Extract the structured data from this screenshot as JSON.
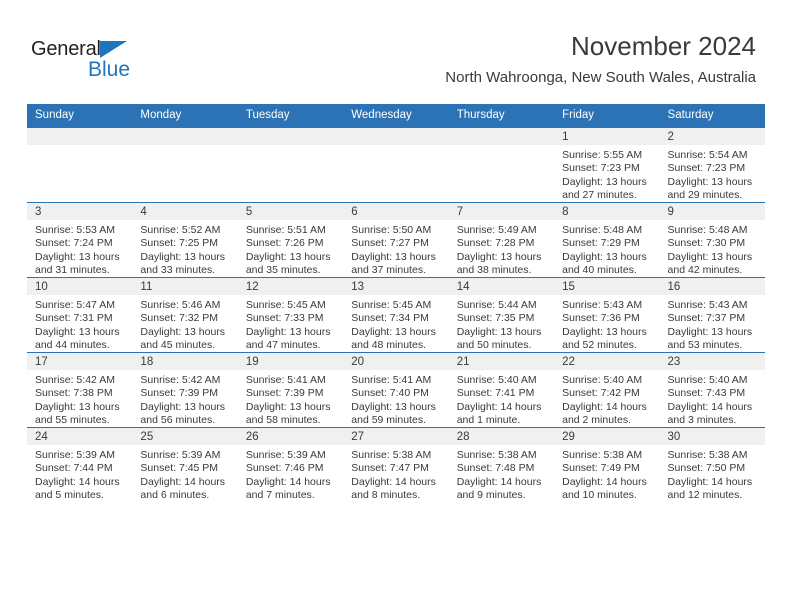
{
  "brand": {
    "name_top": "General",
    "name_bottom": "Blue",
    "color_dark": "#231f20",
    "color_blue": "#1f76bc"
  },
  "header": {
    "title": "November 2024",
    "subtitle": "North Wahroonga, New South Wales, Australia"
  },
  "theme": {
    "header_bg": "#2c73b5",
    "daynum_bg": "#f0f0f0",
    "text": "#3a3a3a"
  },
  "calendar": {
    "weekday_headers": [
      "Sunday",
      "Monday",
      "Tuesday",
      "Wednesday",
      "Thursday",
      "Friday",
      "Saturday"
    ],
    "labels": {
      "sunrise": "Sunrise:",
      "sunset": "Sunset:",
      "daylight": "Daylight:"
    },
    "weeks": [
      [
        {
          "day": "",
          "sunrise": "",
          "sunset": "",
          "daylight": ""
        },
        {
          "day": "",
          "sunrise": "",
          "sunset": "",
          "daylight": ""
        },
        {
          "day": "",
          "sunrise": "",
          "sunset": "",
          "daylight": ""
        },
        {
          "day": "",
          "sunrise": "",
          "sunset": "",
          "daylight": ""
        },
        {
          "day": "",
          "sunrise": "",
          "sunset": "",
          "daylight": ""
        },
        {
          "day": "1",
          "sunrise": "Sunrise: 5:55 AM",
          "sunset": "Sunset: 7:23 PM",
          "daylight": "Daylight: 13 hours and 27 minutes."
        },
        {
          "day": "2",
          "sunrise": "Sunrise: 5:54 AM",
          "sunset": "Sunset: 7:23 PM",
          "daylight": "Daylight: 13 hours and 29 minutes."
        }
      ],
      [
        {
          "day": "3",
          "sunrise": "Sunrise: 5:53 AM",
          "sunset": "Sunset: 7:24 PM",
          "daylight": "Daylight: 13 hours and 31 minutes."
        },
        {
          "day": "4",
          "sunrise": "Sunrise: 5:52 AM",
          "sunset": "Sunset: 7:25 PM",
          "daylight": "Daylight: 13 hours and 33 minutes."
        },
        {
          "day": "5",
          "sunrise": "Sunrise: 5:51 AM",
          "sunset": "Sunset: 7:26 PM",
          "daylight": "Daylight: 13 hours and 35 minutes."
        },
        {
          "day": "6",
          "sunrise": "Sunrise: 5:50 AM",
          "sunset": "Sunset: 7:27 PM",
          "daylight": "Daylight: 13 hours and 37 minutes."
        },
        {
          "day": "7",
          "sunrise": "Sunrise: 5:49 AM",
          "sunset": "Sunset: 7:28 PM",
          "daylight": "Daylight: 13 hours and 38 minutes."
        },
        {
          "day": "8",
          "sunrise": "Sunrise: 5:48 AM",
          "sunset": "Sunset: 7:29 PM",
          "daylight": "Daylight: 13 hours and 40 minutes."
        },
        {
          "day": "9",
          "sunrise": "Sunrise: 5:48 AM",
          "sunset": "Sunset: 7:30 PM",
          "daylight": "Daylight: 13 hours and 42 minutes."
        }
      ],
      [
        {
          "day": "10",
          "sunrise": "Sunrise: 5:47 AM",
          "sunset": "Sunset: 7:31 PM",
          "daylight": "Daylight: 13 hours and 44 minutes."
        },
        {
          "day": "11",
          "sunrise": "Sunrise: 5:46 AM",
          "sunset": "Sunset: 7:32 PM",
          "daylight": "Daylight: 13 hours and 45 minutes."
        },
        {
          "day": "12",
          "sunrise": "Sunrise: 5:45 AM",
          "sunset": "Sunset: 7:33 PM",
          "daylight": "Daylight: 13 hours and 47 minutes."
        },
        {
          "day": "13",
          "sunrise": "Sunrise: 5:45 AM",
          "sunset": "Sunset: 7:34 PM",
          "daylight": "Daylight: 13 hours and 48 minutes."
        },
        {
          "day": "14",
          "sunrise": "Sunrise: 5:44 AM",
          "sunset": "Sunset: 7:35 PM",
          "daylight": "Daylight: 13 hours and 50 minutes."
        },
        {
          "day": "15",
          "sunrise": "Sunrise: 5:43 AM",
          "sunset": "Sunset: 7:36 PM",
          "daylight": "Daylight: 13 hours and 52 minutes."
        },
        {
          "day": "16",
          "sunrise": "Sunrise: 5:43 AM",
          "sunset": "Sunset: 7:37 PM",
          "daylight": "Daylight: 13 hours and 53 minutes."
        }
      ],
      [
        {
          "day": "17",
          "sunrise": "Sunrise: 5:42 AM",
          "sunset": "Sunset: 7:38 PM",
          "daylight": "Daylight: 13 hours and 55 minutes."
        },
        {
          "day": "18",
          "sunrise": "Sunrise: 5:42 AM",
          "sunset": "Sunset: 7:39 PM",
          "daylight": "Daylight: 13 hours and 56 minutes."
        },
        {
          "day": "19",
          "sunrise": "Sunrise: 5:41 AM",
          "sunset": "Sunset: 7:39 PM",
          "daylight": "Daylight: 13 hours and 58 minutes."
        },
        {
          "day": "20",
          "sunrise": "Sunrise: 5:41 AM",
          "sunset": "Sunset: 7:40 PM",
          "daylight": "Daylight: 13 hours and 59 minutes."
        },
        {
          "day": "21",
          "sunrise": "Sunrise: 5:40 AM",
          "sunset": "Sunset: 7:41 PM",
          "daylight": "Daylight: 14 hours and 1 minute."
        },
        {
          "day": "22",
          "sunrise": "Sunrise: 5:40 AM",
          "sunset": "Sunset: 7:42 PM",
          "daylight": "Daylight: 14 hours and 2 minutes."
        },
        {
          "day": "23",
          "sunrise": "Sunrise: 5:40 AM",
          "sunset": "Sunset: 7:43 PM",
          "daylight": "Daylight: 14 hours and 3 minutes."
        }
      ],
      [
        {
          "day": "24",
          "sunrise": "Sunrise: 5:39 AM",
          "sunset": "Sunset: 7:44 PM",
          "daylight": "Daylight: 14 hours and 5 minutes."
        },
        {
          "day": "25",
          "sunrise": "Sunrise: 5:39 AM",
          "sunset": "Sunset: 7:45 PM",
          "daylight": "Daylight: 14 hours and 6 minutes."
        },
        {
          "day": "26",
          "sunrise": "Sunrise: 5:39 AM",
          "sunset": "Sunset: 7:46 PM",
          "daylight": "Daylight: 14 hours and 7 minutes."
        },
        {
          "day": "27",
          "sunrise": "Sunrise: 5:38 AM",
          "sunset": "Sunset: 7:47 PM",
          "daylight": "Daylight: 14 hours and 8 minutes."
        },
        {
          "day": "28",
          "sunrise": "Sunrise: 5:38 AM",
          "sunset": "Sunset: 7:48 PM",
          "daylight": "Daylight: 14 hours and 9 minutes."
        },
        {
          "day": "29",
          "sunrise": "Sunrise: 5:38 AM",
          "sunset": "Sunset: 7:49 PM",
          "daylight": "Daylight: 14 hours and 10 minutes."
        },
        {
          "day": "30",
          "sunrise": "Sunrise: 5:38 AM",
          "sunset": "Sunset: 7:50 PM",
          "daylight": "Daylight: 14 hours and 12 minutes."
        }
      ]
    ]
  }
}
